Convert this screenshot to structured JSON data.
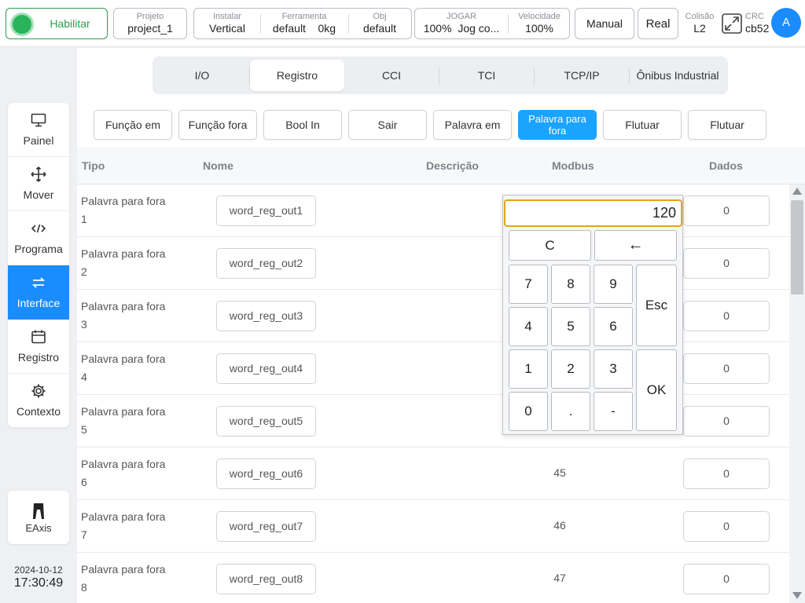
{
  "topbar": {
    "enable_label": "Habilitar",
    "project": {
      "label": "Projeto",
      "value": "project_1"
    },
    "install": {
      "label": "Instalar",
      "value": "Vertical"
    },
    "tool": {
      "label": "Ferramenta",
      "value": "default",
      "weight": "0kg"
    },
    "obj": {
      "label": "Obj",
      "value": "default"
    },
    "jog": {
      "label": "JOGAR",
      "value": "100%",
      "mode": "Jog co..."
    },
    "speed": {
      "label": "Velocidade",
      "value": "100%"
    },
    "manual_label": "Manual",
    "real_label": "Real",
    "collision": {
      "label": "Colisão",
      "value": "L2"
    },
    "crc": {
      "label": "CRC",
      "value": "cb52"
    },
    "avatar": "A"
  },
  "nav": {
    "items": [
      {
        "label": "Painel",
        "icon": "monitor-icon"
      },
      {
        "label": "Mover",
        "icon": "move-icon"
      },
      {
        "label": "Programa",
        "icon": "code-icon"
      },
      {
        "label": "Interface",
        "icon": "swap-icon",
        "active": true
      },
      {
        "label": "Registro",
        "icon": "calendar-icon"
      },
      {
        "label": "Contexto",
        "icon": "gear-icon"
      }
    ],
    "eaxis_label": "EAxis",
    "date": "2024-10-12",
    "time": "17:30:49"
  },
  "tabs": [
    {
      "label": "I/O"
    },
    {
      "label": "Registro",
      "active": true
    },
    {
      "label": "CCI"
    },
    {
      "label": "TCI"
    },
    {
      "label": "TCP/IP"
    },
    {
      "label": "Ônibus Industrial"
    }
  ],
  "subtabs": [
    {
      "label": "Função em"
    },
    {
      "label": "Função fora"
    },
    {
      "label": "Bool In"
    },
    {
      "label": "Sair"
    },
    {
      "label": "Palavra em"
    },
    {
      "label": "Palavra para fora",
      "active": true
    },
    {
      "label": "Flutuar"
    },
    {
      "label": "Flutuar"
    }
  ],
  "table": {
    "headers": {
      "type": "Tipo",
      "name": "Nome",
      "desc": "Descrição",
      "modbus": "Modbus",
      "data": "Dados"
    },
    "rows": [
      {
        "type": "Palavra para fora",
        "index": "1",
        "name": "word_reg_out1",
        "modbus": "",
        "data": "0"
      },
      {
        "type": "Palavra para fora",
        "index": "2",
        "name": "word_reg_out2",
        "modbus": "",
        "data": "0"
      },
      {
        "type": "Palavra para fora",
        "index": "3",
        "name": "word_reg_out3",
        "modbus": "",
        "data": "0"
      },
      {
        "type": "Palavra para fora",
        "index": "4",
        "name": "word_reg_out4",
        "modbus": "",
        "data": "0"
      },
      {
        "type": "Palavra para fora",
        "index": "5",
        "name": "word_reg_out5",
        "modbus": "",
        "data": "0"
      },
      {
        "type": "Palavra para fora",
        "index": "6",
        "name": "word_reg_out6",
        "modbus": "45",
        "data": "0"
      },
      {
        "type": "Palavra para fora",
        "index": "7",
        "name": "word_reg_out7",
        "modbus": "46",
        "data": "0"
      },
      {
        "type": "Palavra para fora",
        "index": "8",
        "name": "word_reg_out8",
        "modbus": "47",
        "data": "0"
      }
    ]
  },
  "keypad": {
    "display": "120",
    "clear": "C",
    "backspace": "←",
    "esc": "Esc",
    "ok": "OK",
    "digits": {
      "d7": "7",
      "d8": "8",
      "d9": "9",
      "d4": "4",
      "d5": "5",
      "d6": "6",
      "d1": "1",
      "d2": "2",
      "d3": "3",
      "d0": "0"
    },
    "dot": ".",
    "minus": "-"
  }
}
